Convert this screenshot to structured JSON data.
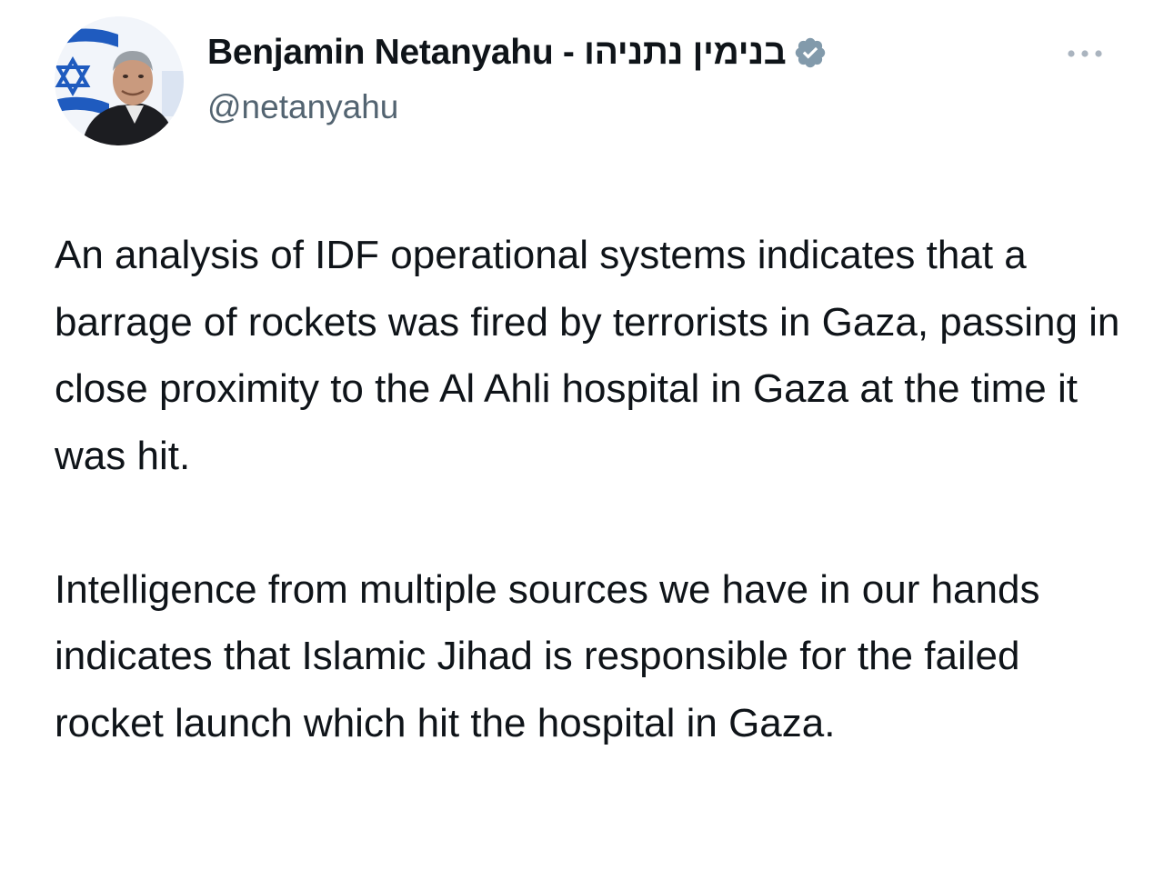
{
  "author": {
    "display_name": "Benjamin Netanyahu - בנימין נתניהו",
    "handle": "@netanyahu",
    "verified": true,
    "avatar_icon": "profile-photo-with-israeli-flag"
  },
  "tweet": {
    "paragraphs": [
      "An analysis of IDF operational systems indicates that a barrage of rockets was fired by terrorists in Gaza, passing in close proximity to the Al Ahli hospital in Gaza at the time it was hit.",
      "Intelligence from multiple sources we have in our hands indicates that Islamic Jihad is responsible for the failed rocket launch which hit the hospital in Gaza."
    ]
  },
  "icons": {
    "verified": "verified-badge-icon",
    "more": "more-horizontal-icon"
  },
  "colors": {
    "text_primary": "#0f1419",
    "text_secondary": "#536471",
    "verified_badge": "#829aab",
    "flag_blue": "#1f5bbf"
  }
}
